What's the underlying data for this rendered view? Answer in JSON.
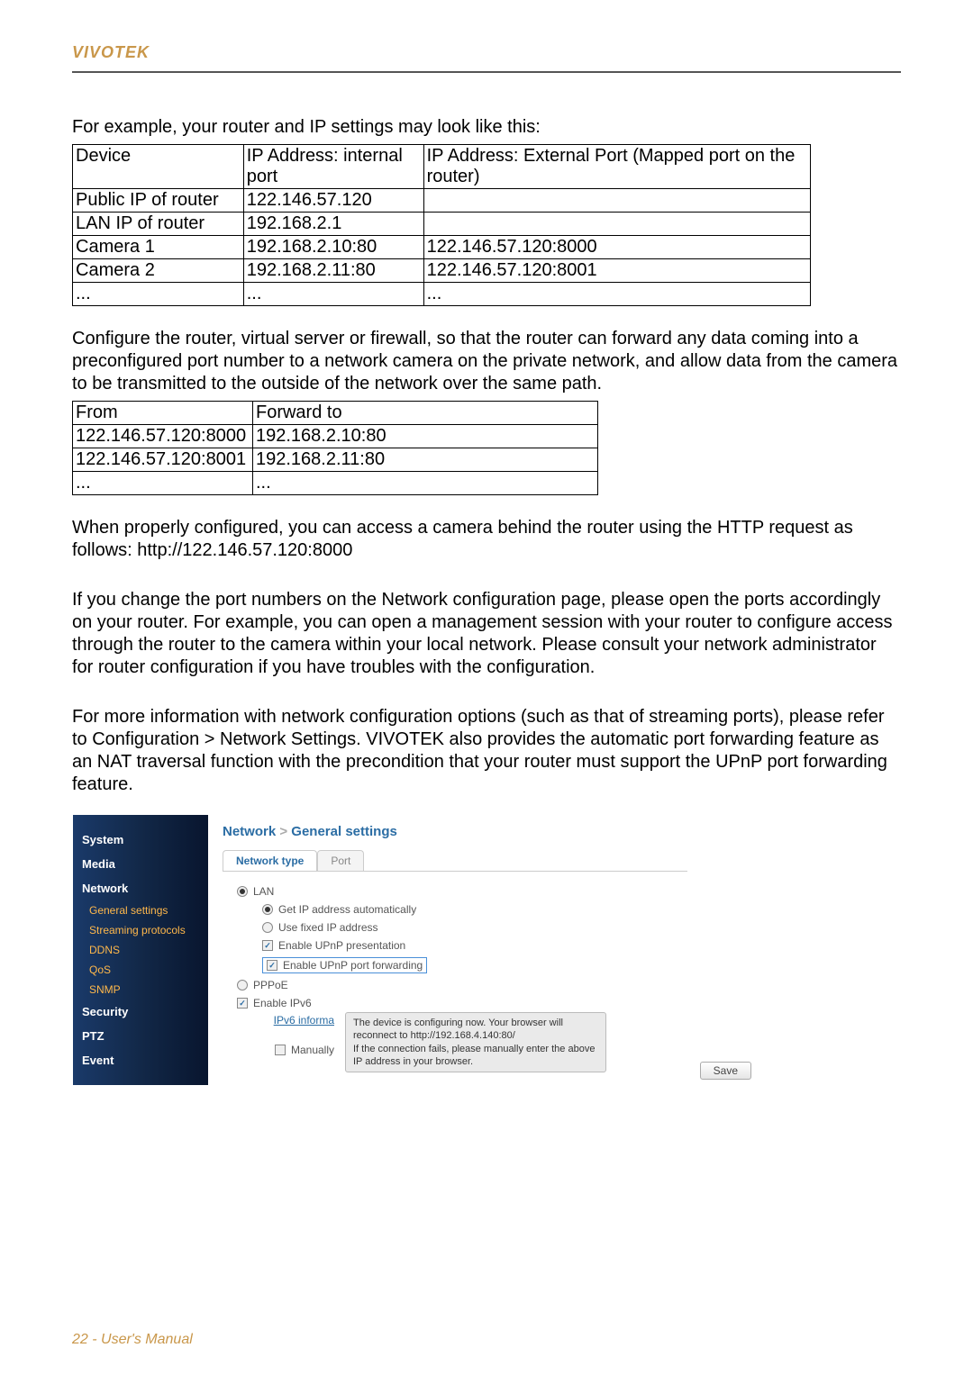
{
  "header": {
    "brand": "VIVOTEK"
  },
  "intro": "For example, your router and IP settings may look like this:",
  "table1": {
    "headers": [
      "Device",
      "IP Address: internal port",
      "IP Address: External Port (Mapped port on the router)"
    ],
    "rows": [
      [
        "Public IP of router",
        "122.146.57.120",
        ""
      ],
      [
        "LAN IP of router",
        "192.168.2.1",
        ""
      ],
      [
        "Camera 1",
        "192.168.2.10:80",
        "122.146.57.120:8000"
      ],
      [
        "Camera 2",
        "192.168.2.11:80",
        "122.146.57.120:8001"
      ],
      [
        "...",
        "...",
        "..."
      ]
    ]
  },
  "para1": "Configure the router, virtual server or firewall, so that the router can forward any data coming into a preconfigured port number to a network camera on the private network, and allow data from the camera to be transmitted to the outside of the network over the same path.",
  "table2": {
    "headers": [
      "From",
      "Forward to"
    ],
    "rows": [
      [
        "122.146.57.120:8000",
        "192.168.2.10:80"
      ],
      [
        "122.146.57.120:8001",
        "192.168.2.11:80"
      ],
      [
        "...",
        "..."
      ]
    ]
  },
  "para2": "When properly configured, you can access a camera behind the router using the HTTP request as follows: http://122.146.57.120:8000",
  "para3": "If you change the port numbers on the Network configuration page, please open the ports accordingly on your router. For example, you can open a management session with your router to configure access through the router to the camera within your local network. Please consult your network administrator for router configuration if you have troubles with the configuration.",
  "para4": "For more information with network configuration options (such as that of streaming ports), please refer to Configuration > Network Settings. VIVOTEK also provides the automatic port forwarding feature as an NAT traversal function with the precondition that your router must support the UPnP port forwarding feature.",
  "screenshot": {
    "breadcrumb": {
      "a": "Network",
      "sep": ">",
      "b": "General settings"
    },
    "sidebar": {
      "items": [
        {
          "type": "head",
          "label": "System"
        },
        {
          "type": "head",
          "label": "Media"
        },
        {
          "type": "head",
          "label": "Network"
        },
        {
          "type": "sub",
          "label": "General settings",
          "selected": true
        },
        {
          "type": "sub",
          "label": "Streaming protocols"
        },
        {
          "type": "sub",
          "label": "DDNS"
        },
        {
          "type": "sub",
          "label": "QoS"
        },
        {
          "type": "sub",
          "label": "SNMP"
        },
        {
          "type": "head",
          "label": "Security"
        },
        {
          "type": "head",
          "label": "PTZ"
        },
        {
          "type": "head",
          "label": "Event"
        }
      ]
    },
    "tabs": [
      {
        "label": "Network type",
        "active": true
      },
      {
        "label": "Port",
        "active": false
      }
    ],
    "form": {
      "lan": "LAN",
      "get_auto": "Get IP address automatically",
      "fixed": "Use fixed IP address",
      "upnp_pres": "Enable UPnP presentation",
      "upnp_fwd": "Enable UPnP port forwarding",
      "pppoe": "PPPoE",
      "ipv6_enable": "Enable IPv6",
      "ipv6_info_label": "IPv6 informa",
      "manually": "Manually",
      "tooltip1": "The device is configuring now. Your browser will reconnect to http://192.168.4.140:80/",
      "tooltip2": "If the connection fails, please manually enter the above IP address in your browser."
    },
    "save": "Save"
  },
  "footer": "22 - User's Manual"
}
